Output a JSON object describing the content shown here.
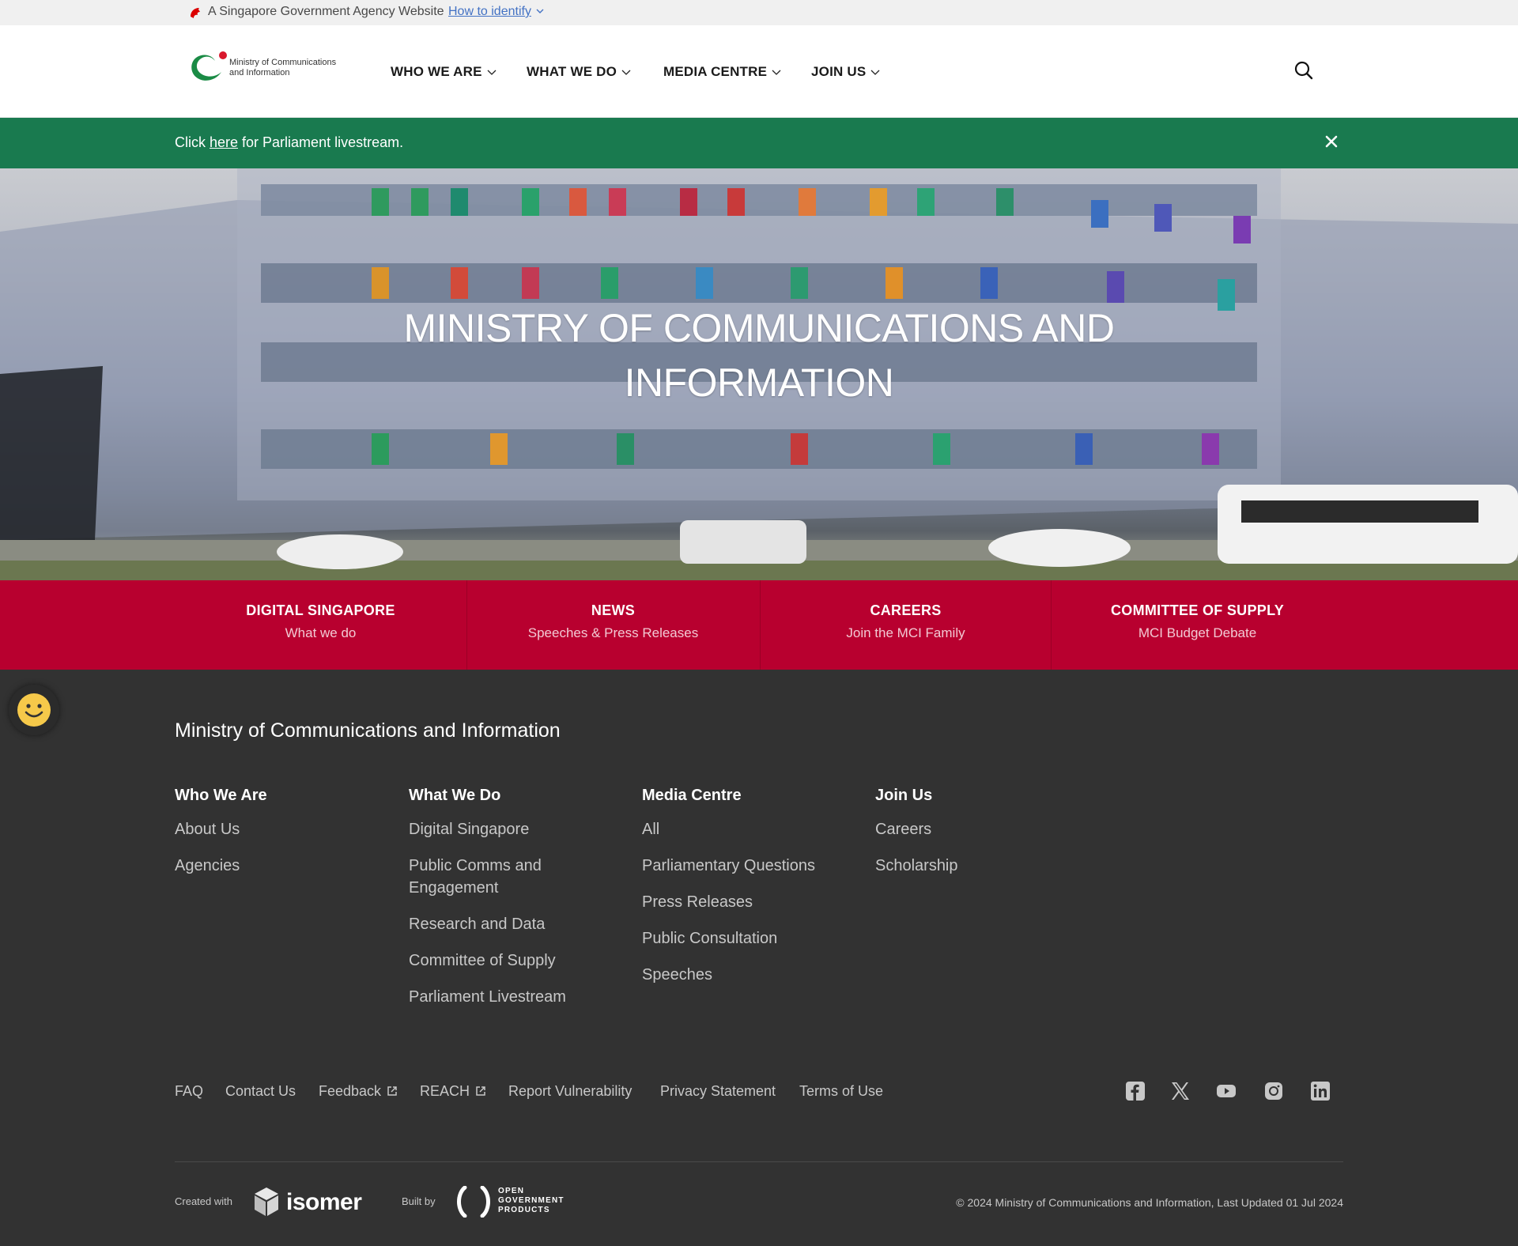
{
  "masthead": {
    "text": "A Singapore Government Agency Website",
    "identify_link": "How to identify"
  },
  "header": {
    "logo_line1": "Ministry of Communications",
    "logo_line2": "and Information",
    "nav": [
      {
        "label": "WHO WE ARE"
      },
      {
        "label": "WHAT WE DO"
      },
      {
        "label": "MEDIA CENTRE"
      },
      {
        "label": "JOIN US"
      }
    ],
    "search_icon": "search-icon"
  },
  "banner": {
    "prefix": "Click ",
    "link": "here",
    "suffix": " for Parliament livestream.",
    "color": "#197a4f"
  },
  "hero": {
    "title_line1": "MINISTRY OF COMMUNICATIONS AND",
    "title_line2": "INFORMATION"
  },
  "quick_links": {
    "color": "#b8002f",
    "items": [
      {
        "title": "DIGITAL SINGAPORE",
        "subtitle": "What we do"
      },
      {
        "title": "NEWS",
        "subtitle": "Speeches & Press Releases"
      },
      {
        "title": "CAREERS",
        "subtitle": "Join the MCI Family"
      },
      {
        "title": "COMMITTEE OF SUPPLY",
        "subtitle": "MCI Budget Debate"
      }
    ]
  },
  "footer": {
    "title": "Ministry of Communications and Information",
    "columns": [
      {
        "heading": "Who We Are",
        "items": [
          "About Us",
          "Agencies"
        ]
      },
      {
        "heading": "What We Do",
        "items": [
          "Digital Singapore",
          "Public Comms and Engagement",
          "Research and Data",
          "Committee of Supply",
          "Parliament Livestream"
        ]
      },
      {
        "heading": "Media Centre",
        "items": [
          "All",
          "Parliamentary Questions",
          "Press Releases",
          "Public Consultation",
          "Speeches"
        ]
      },
      {
        "heading": "Join Us",
        "items": [
          "Careers",
          "Scholarship"
        ]
      }
    ],
    "bottom_links": [
      "FAQ",
      "Contact Us",
      "Feedback",
      "REACH",
      "Report Vulnerability",
      "Privacy Statement",
      "Terms of Use"
    ],
    "social": [
      "facebook-icon",
      "x-icon",
      "youtube-icon",
      "instagram-icon",
      "linkedin-icon"
    ],
    "created_with": "Created with",
    "isomer": "isomer",
    "built_by": "Built by",
    "ogp_line1": "OPEN",
    "ogp_line2": "GOVERNMENT",
    "ogp_line3": "PRODUCTS",
    "copyright": "© 2024 Ministry of Communications and Information, Last Updated 01 Jul 2024"
  }
}
